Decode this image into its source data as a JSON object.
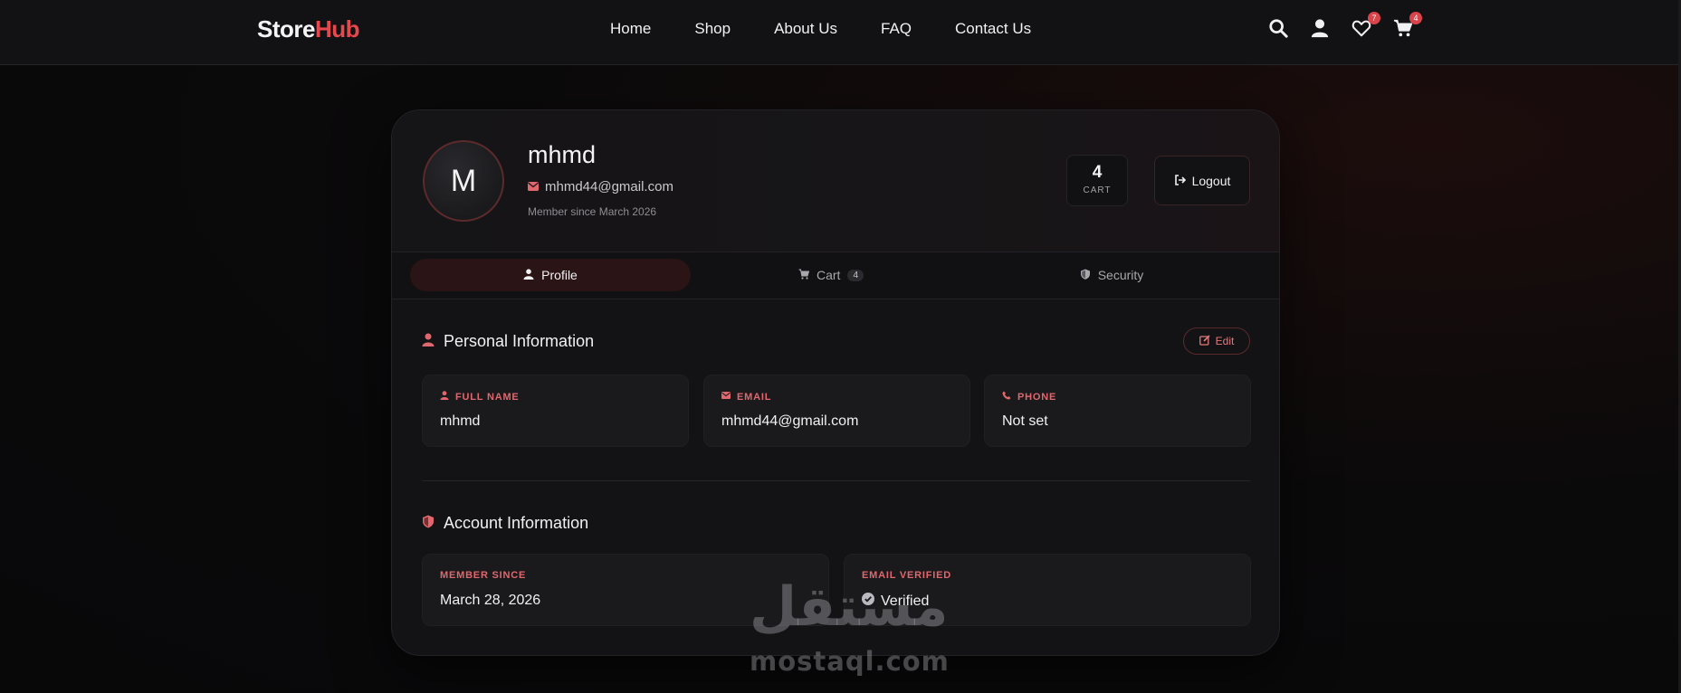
{
  "brand": {
    "part1": "Store",
    "part2": "Hub"
  },
  "nav": {
    "links": [
      "Home",
      "Shop",
      "About Us",
      "FAQ",
      "Contact Us"
    ],
    "wishlist_count": "7",
    "cart_count": "4",
    "icons": [
      "search-icon",
      "user-icon",
      "heart-icon",
      "cart-icon"
    ]
  },
  "profile": {
    "avatar_letter": "M",
    "name": "mhmd",
    "email": "mhmd44@gmail.com",
    "member_since": "Member since March 2026",
    "cart_stat_value": "4",
    "cart_stat_label": "CART",
    "logout_label": "Logout"
  },
  "tabs": [
    {
      "label": "Profile",
      "active": true
    },
    {
      "label": "Cart",
      "count": "4",
      "active": false
    },
    {
      "label": "Security",
      "active": false
    }
  ],
  "personal": {
    "title": "Personal Information",
    "edit_label": "Edit",
    "fields": [
      {
        "label": "FULL NAME",
        "value": "mhmd"
      },
      {
        "label": "EMAIL",
        "value": "mhmd44@gmail.com"
      },
      {
        "label": "PHONE",
        "value": "Not set"
      }
    ]
  },
  "account": {
    "title": "Account Information",
    "fields": [
      {
        "label": "MEMBER SINCE",
        "value": "March 28, 2026"
      },
      {
        "label": "EMAIL VERIFIED",
        "value": "Verified"
      }
    ]
  },
  "watermark": {
    "arabic": "مستقل",
    "latin": "mostaql.com"
  },
  "colors": {
    "accent": "#e5484d",
    "background": "#0b0a0b",
    "card": "#131315"
  }
}
